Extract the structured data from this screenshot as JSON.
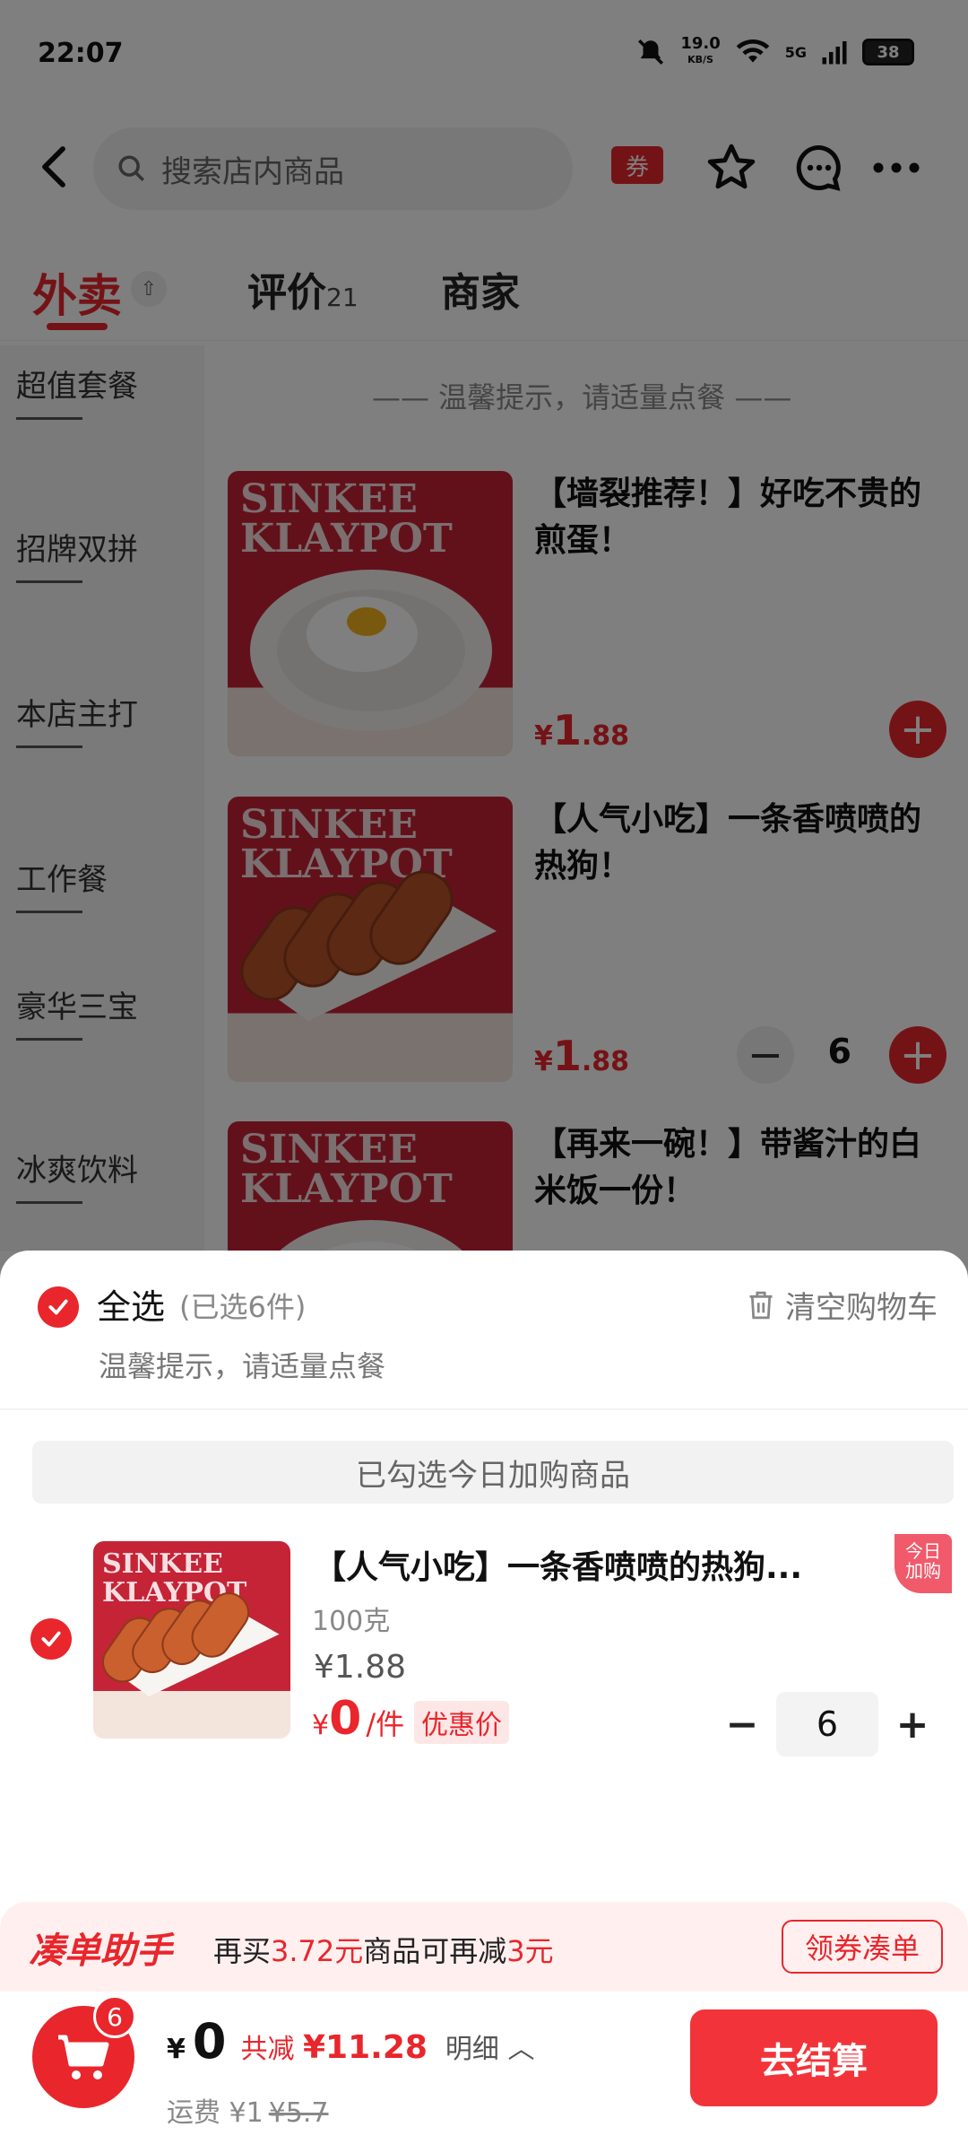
{
  "status_bar": {
    "time": "22:07",
    "net_speed": "19.0",
    "net_unit": "KB/S",
    "network": "5G",
    "battery": "38"
  },
  "nav": {
    "search_placeholder": "搜索店内商品",
    "coupon_label": "券"
  },
  "tabs": [
    {
      "label": "外卖",
      "count": ""
    },
    {
      "label": "评价",
      "count": "21"
    },
    {
      "label": "商家",
      "count": ""
    }
  ],
  "sidebar": {
    "items": [
      "超值套餐",
      "招牌双拼",
      "本店主打",
      "工作餐",
      "豪华三宝",
      "冰爽饮料"
    ]
  },
  "menu_tip": "—— 温馨提示，请适量点餐 ——",
  "brand_text": [
    "SINKEE",
    "KLAYPOT"
  ],
  "products": [
    {
      "title": "【墙裂推荐！】好吃不贵的煎蛋！",
      "price_symbol": "¥",
      "price_int": "1",
      "price_dec": ".88",
      "qty": ""
    },
    {
      "title": "【人气小吃】一条香喷喷的热狗！",
      "price_symbol": "¥",
      "price_int": "1",
      "price_dec": ".88",
      "qty": "6"
    },
    {
      "title": "【再来一碗！】带酱汁的白米饭一份！",
      "price_symbol": "¥",
      "price_int": "1",
      "price_dec": ".88",
      "qty": ""
    }
  ],
  "cart": {
    "select_all": "全选",
    "selected_count": "(已选6件)",
    "clear_label": "清空购物车",
    "tip": "温馨提示，请适量点餐",
    "section_banner": "已勾选今日加购商品",
    "item": {
      "title": "【人气小吃】一条香喷喷的热狗...",
      "spec": "100克",
      "original_price": "¥1.88",
      "price_symbol": "¥",
      "price": "0",
      "unit": "/件",
      "promo_tag": "优惠价",
      "corner_tag_line1": "今日",
      "corner_tag_line2": "加购",
      "quantity": "6"
    }
  },
  "helper": {
    "title": "凑单助手",
    "text_prefix": "再买",
    "amount": "3.72元",
    "text_mid": "商品可再减",
    "discount": "3元",
    "button": "领券凑单"
  },
  "checkout": {
    "badge": "6",
    "symbol": "¥",
    "total": "0",
    "discount_label": "共减",
    "discount_amount": "¥11.28",
    "detail_label": "明细",
    "shipping_label": "运费 ¥1",
    "shipping_original": "¥5.7",
    "pay_button": "去结算"
  },
  "colors": {
    "accent": "#e8262c",
    "overlay": "rgba(0,0,0,0.5)"
  }
}
